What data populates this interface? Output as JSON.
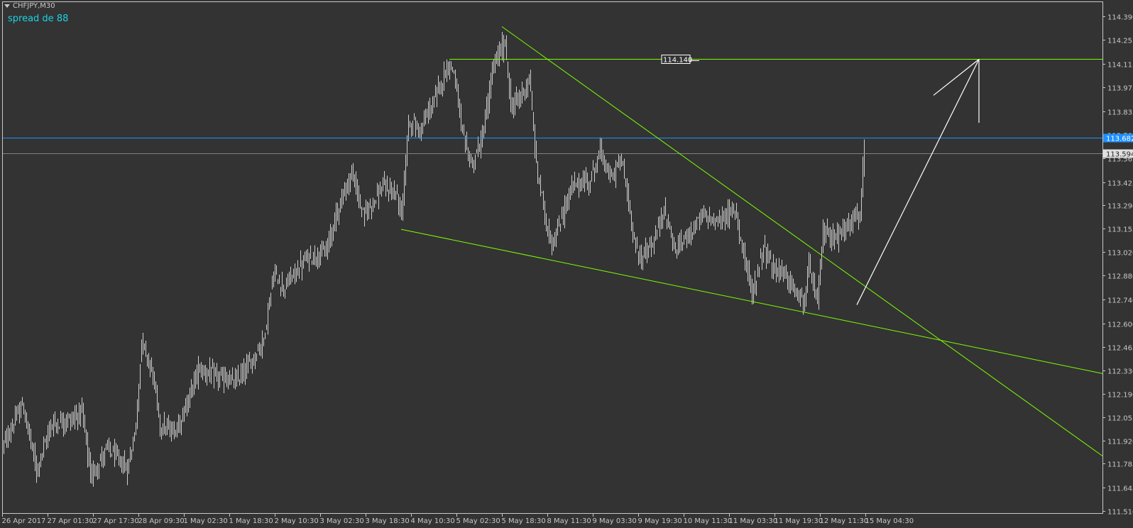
{
  "header": {
    "symbol_label": "CHFJPY,M30",
    "spread_label": "spread de 88",
    "menu_icon": "triangle-down-icon"
  },
  "colors": {
    "background": "#333333",
    "bars": "#cfcfcf",
    "frame": "#c8c8c8",
    "trendline": "#7cfc00",
    "bid_line": "#1e90ff",
    "ask_line": "#808080",
    "arrow": "#ffffff",
    "spread_text": "#19d3e6"
  },
  "chart_data": {
    "type": "ohlc",
    "symbol": "CHFJPY",
    "timeframe": "M30",
    "ylim": [
      111.51,
      114.39
    ],
    "bar_count": 608,
    "price_ticks": [
      "114.390",
      "114.255",
      "114.115",
      "113.975",
      "113.835",
      "113.700",
      "113.565",
      "113.425",
      "113.290",
      "113.155",
      "113.020",
      "112.880",
      "112.740",
      "112.600",
      "112.465",
      "112.330",
      "112.190",
      "112.055",
      "111.920",
      "111.785",
      "111.645",
      "111.510"
    ],
    "time_ticks": [
      "26 Apr 2017",
      "27 Apr 01:30",
      "27 Apr 17:30",
      "28 Apr 09:30",
      "1 May 02:30",
      "1 May 18:30",
      "2 May 10:30",
      "3 May 02:30",
      "3 May 18:30",
      "4 May 10:30",
      "5 May 02:30",
      "5 May 18:30",
      "8 May 11:30",
      "9 May 03:30",
      "9 May 19:30",
      "10 May 11:30",
      "11 May 03:30",
      "11 May 19:30",
      "12 May 11:30",
      "15 May 04:30"
    ],
    "bars_per_time_tick": 32,
    "close_path": [
      [
        0,
        111.88
      ],
      [
        14,
        112.13
      ],
      [
        24,
        111.75
      ],
      [
        34,
        112.01
      ],
      [
        49,
        112.05
      ],
      [
        56,
        112.09
      ],
      [
        62,
        111.71
      ],
      [
        74,
        111.88
      ],
      [
        88,
        111.75
      ],
      [
        94,
        112.01
      ],
      [
        98,
        112.51
      ],
      [
        106,
        112.3
      ],
      [
        111,
        112.01
      ],
      [
        121,
        111.97
      ],
      [
        128,
        112.09
      ],
      [
        138,
        112.34
      ],
      [
        148,
        112.3
      ],
      [
        164,
        112.26
      ],
      [
        176,
        112.39
      ],
      [
        184,
        112.51
      ],
      [
        191,
        112.89
      ],
      [
        198,
        112.81
      ],
      [
        214,
        112.98
      ],
      [
        228,
        113.02
      ],
      [
        236,
        113.27
      ],
      [
        246,
        113.48
      ],
      [
        254,
        113.23
      ],
      [
        268,
        113.4
      ],
      [
        278,
        113.35
      ],
      [
        281,
        113.23
      ],
      [
        286,
        113.78
      ],
      [
        294,
        113.73
      ],
      [
        304,
        113.9
      ],
      [
        314,
        114.11
      ],
      [
        318,
        114.07
      ],
      [
        324,
        113.69
      ],
      [
        331,
        113.52
      ],
      [
        338,
        113.69
      ],
      [
        346,
        114.11
      ],
      [
        354,
        114.24
      ],
      [
        358,
        113.86
      ],
      [
        366,
        113.94
      ],
      [
        371,
        114.03
      ],
      [
        376,
        113.52
      ],
      [
        384,
        113.14
      ],
      [
        388,
        113.06
      ],
      [
        394,
        113.23
      ],
      [
        401,
        113.4
      ],
      [
        414,
        113.44
      ],
      [
        421,
        113.61
      ],
      [
        428,
        113.44
      ],
      [
        436,
        113.56
      ],
      [
        444,
        113.14
      ],
      [
        448,
        112.98
      ],
      [
        458,
        113.06
      ],
      [
        466,
        113.27
      ],
      [
        474,
        113.02
      ],
      [
        484,
        113.14
      ],
      [
        494,
        113.23
      ],
      [
        504,
        113.19
      ],
      [
        516,
        113.27
      ],
      [
        524,
        112.93
      ],
      [
        528,
        112.76
      ],
      [
        536,
        113.06
      ],
      [
        544,
        112.89
      ],
      [
        548,
        112.93
      ],
      [
        556,
        112.81
      ],
      [
        564,
        112.72
      ],
      [
        568,
        112.93
      ],
      [
        574,
        112.72
      ],
      [
        578,
        113.14
      ],
      [
        588,
        113.1
      ],
      [
        598,
        113.21
      ],
      [
        604,
        113.23
      ],
      [
        607,
        113.6
      ]
    ],
    "horizontal_levels": [
      {
        "name": "bid",
        "price": 113.682,
        "label": "113.682"
      },
      {
        "name": "ask",
        "price": 113.594,
        "label": "113.594"
      }
    ],
    "trendlines": [
      {
        "name": "resistance-horizontal",
        "from": [
          315,
          114.14
        ],
        "to": [
          775,
          114.14
        ],
        "label": "114.140"
      },
      {
        "name": "wedge-upper",
        "from": [
          352,
          114.33
        ],
        "to": [
          775,
          111.83
        ]
      },
      {
        "name": "wedge-lower",
        "from": [
          281,
          113.15
        ],
        "to": [
          775,
          112.31
        ]
      }
    ],
    "arrow": {
      "from": [
        602,
        112.71
      ],
      "to": [
        688,
        114.14
      ],
      "head_a": [
        656,
        113.93
      ],
      "head_b": [
        688,
        113.77
      ]
    }
  }
}
